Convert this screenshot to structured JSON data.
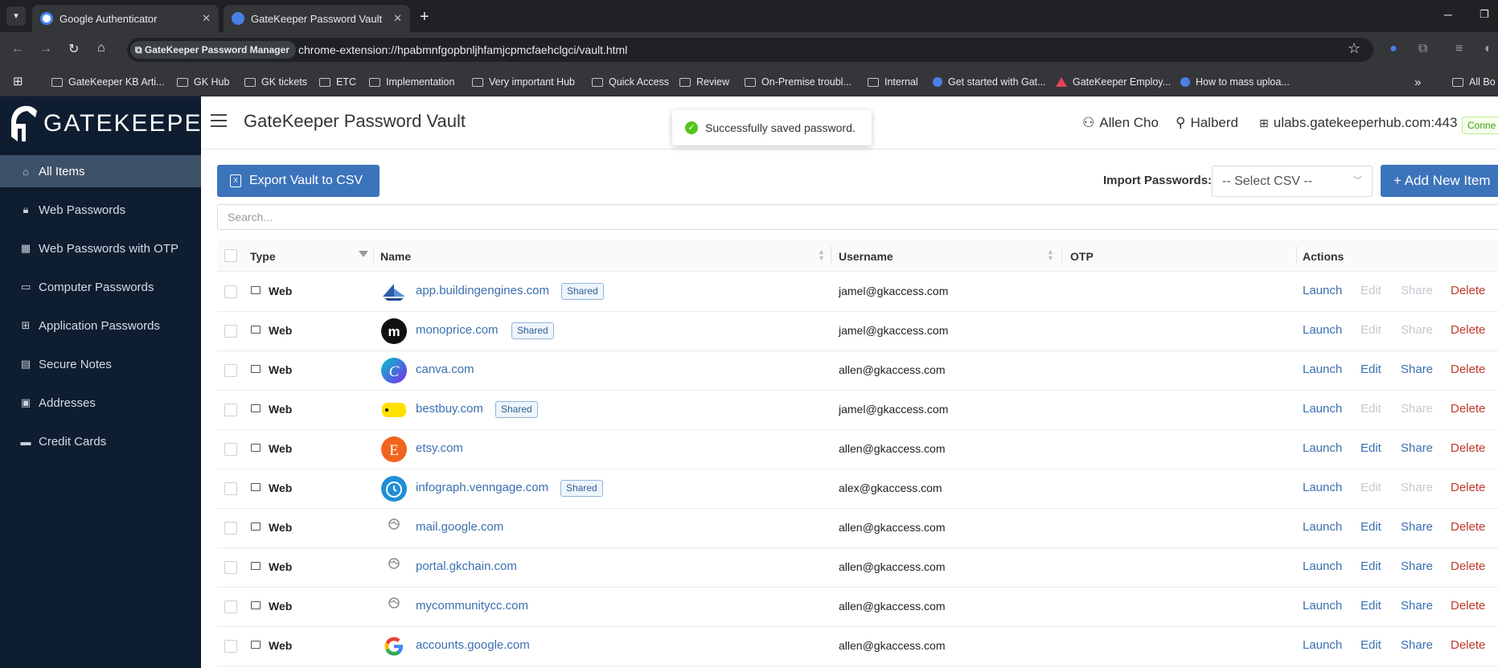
{
  "browser": {
    "tabs": [
      {
        "title": "Google Authenticator",
        "close": "✕"
      },
      {
        "title": "GateKeeper Password Vault",
        "close": "✕"
      }
    ],
    "new_tab": "+",
    "extension_chip": "GateKeeper Password Manager",
    "url": "chrome-extension://hpabmnfgopbnljhfamjcpmcfaehclgci/vault.html",
    "bookmarks": [
      {
        "label": "GateKeeper KB Arti...",
        "icon": "folder-icon"
      },
      {
        "label": "GK Hub",
        "icon": "folder-icon"
      },
      {
        "label": "GK tickets",
        "icon": "folder-icon"
      },
      {
        "label": "ETC",
        "icon": "folder-icon"
      },
      {
        "label": "Implementation",
        "icon": "folder-icon"
      },
      {
        "label": "Very important Hub",
        "icon": "folder-icon"
      },
      {
        "label": "Quick Access",
        "icon": "folder-icon"
      },
      {
        "label": "Review",
        "icon": "folder-icon"
      },
      {
        "label": "On-Premise troubl...",
        "icon": "folder-icon"
      },
      {
        "label": "Internal",
        "icon": "folder-icon"
      },
      {
        "label": "Get started with Gat...",
        "icon": "gatekeeper-icon"
      },
      {
        "label": "GateKeeper Employ...",
        "icon": "warning-triangle-icon"
      },
      {
        "label": "How to mass uploa...",
        "icon": "gatekeeper-icon"
      },
      {
        "label": "»",
        "icon": "chevron-double-right-icon"
      },
      {
        "label": "All Bo",
        "icon": "folder-icon"
      }
    ]
  },
  "sidebar": {
    "logo_text": "GATEKEEPER",
    "items": [
      {
        "label": "All Items",
        "icon": "home-icon",
        "active": true
      },
      {
        "label": "Web Passwords",
        "icon": "lock-icon"
      },
      {
        "label": "Web Passwords with OTP",
        "icon": "qr-icon"
      },
      {
        "label": "Computer Passwords",
        "icon": "laptop-icon"
      },
      {
        "label": "Application Passwords",
        "icon": "apps-icon"
      },
      {
        "label": "Secure Notes",
        "icon": "note-icon"
      },
      {
        "label": "Addresses",
        "icon": "address-card-icon"
      },
      {
        "label": "Credit Cards",
        "icon": "credit-card-icon"
      }
    ]
  },
  "header": {
    "title": "GateKeeper Password Vault",
    "toast": "Successfully saved password.",
    "user_name": "Allen Cho",
    "org": "Halberd",
    "server": "ulabs.gatekeeperhub.com:443",
    "connection": "Conne"
  },
  "toolbar": {
    "export_label": "Export Vault to CSV",
    "import_label": "Import Passwords:",
    "csv_placeholder": "-- Select CSV --",
    "add_label": "+ Add New Item"
  },
  "search": {
    "placeholder": "Search..."
  },
  "table": {
    "headers": {
      "type": "Type",
      "name": "Name",
      "username": "Username",
      "otp": "OTP",
      "actions": "Actions"
    },
    "action_labels": {
      "launch": "Launch",
      "edit": "Edit",
      "share": "Share",
      "delete": "Delete"
    },
    "shared_badge": "Shared",
    "rows": [
      {
        "type": "Web",
        "name": "app.buildingengines.com",
        "shared": true,
        "username": "jamel@gkaccess.com",
        "icon": "buildingengines-icon",
        "editable": false
      },
      {
        "type": "Web",
        "name": "monoprice.com",
        "shared": true,
        "username": "jamel@gkaccess.com",
        "icon": "monoprice-icon",
        "editable": false
      },
      {
        "type": "Web",
        "name": "canva.com",
        "shared": false,
        "username": "allen@gkaccess.com",
        "icon": "canva-icon",
        "editable": true
      },
      {
        "type": "Web",
        "name": "bestbuy.com",
        "shared": true,
        "username": "jamel@gkaccess.com",
        "icon": "bestbuy-icon",
        "editable": false
      },
      {
        "type": "Web",
        "name": "etsy.com",
        "shared": false,
        "username": "allen@gkaccess.com",
        "icon": "etsy-icon",
        "editable": true
      },
      {
        "type": "Web",
        "name": "infograph.venngage.com",
        "shared": true,
        "username": "alex@gkaccess.com",
        "icon": "venngage-icon",
        "editable": false
      },
      {
        "type": "Web",
        "name": "mail.google.com",
        "shared": false,
        "username": "allen@gkaccess.com",
        "icon": "globe-icon",
        "editable": true
      },
      {
        "type": "Web",
        "name": "portal.gkchain.com",
        "shared": false,
        "username": "allen@gkaccess.com",
        "icon": "globe-icon",
        "editable": true
      },
      {
        "type": "Web",
        "name": "mycommunitycc.com",
        "shared": false,
        "username": "allen@gkaccess.com",
        "icon": "globe-icon",
        "editable": true
      },
      {
        "type": "Web",
        "name": "accounts.google.com",
        "shared": false,
        "username": "allen@gkaccess.com",
        "icon": "google-icon",
        "editable": true
      }
    ]
  },
  "colors": {
    "sidebar_bg": "#0f1d30",
    "sidebar_active": "#3d5169",
    "primary": "#3c74bb",
    "link": "#3a6fb0",
    "delete": "#c0392b",
    "success": "#52c41a"
  }
}
